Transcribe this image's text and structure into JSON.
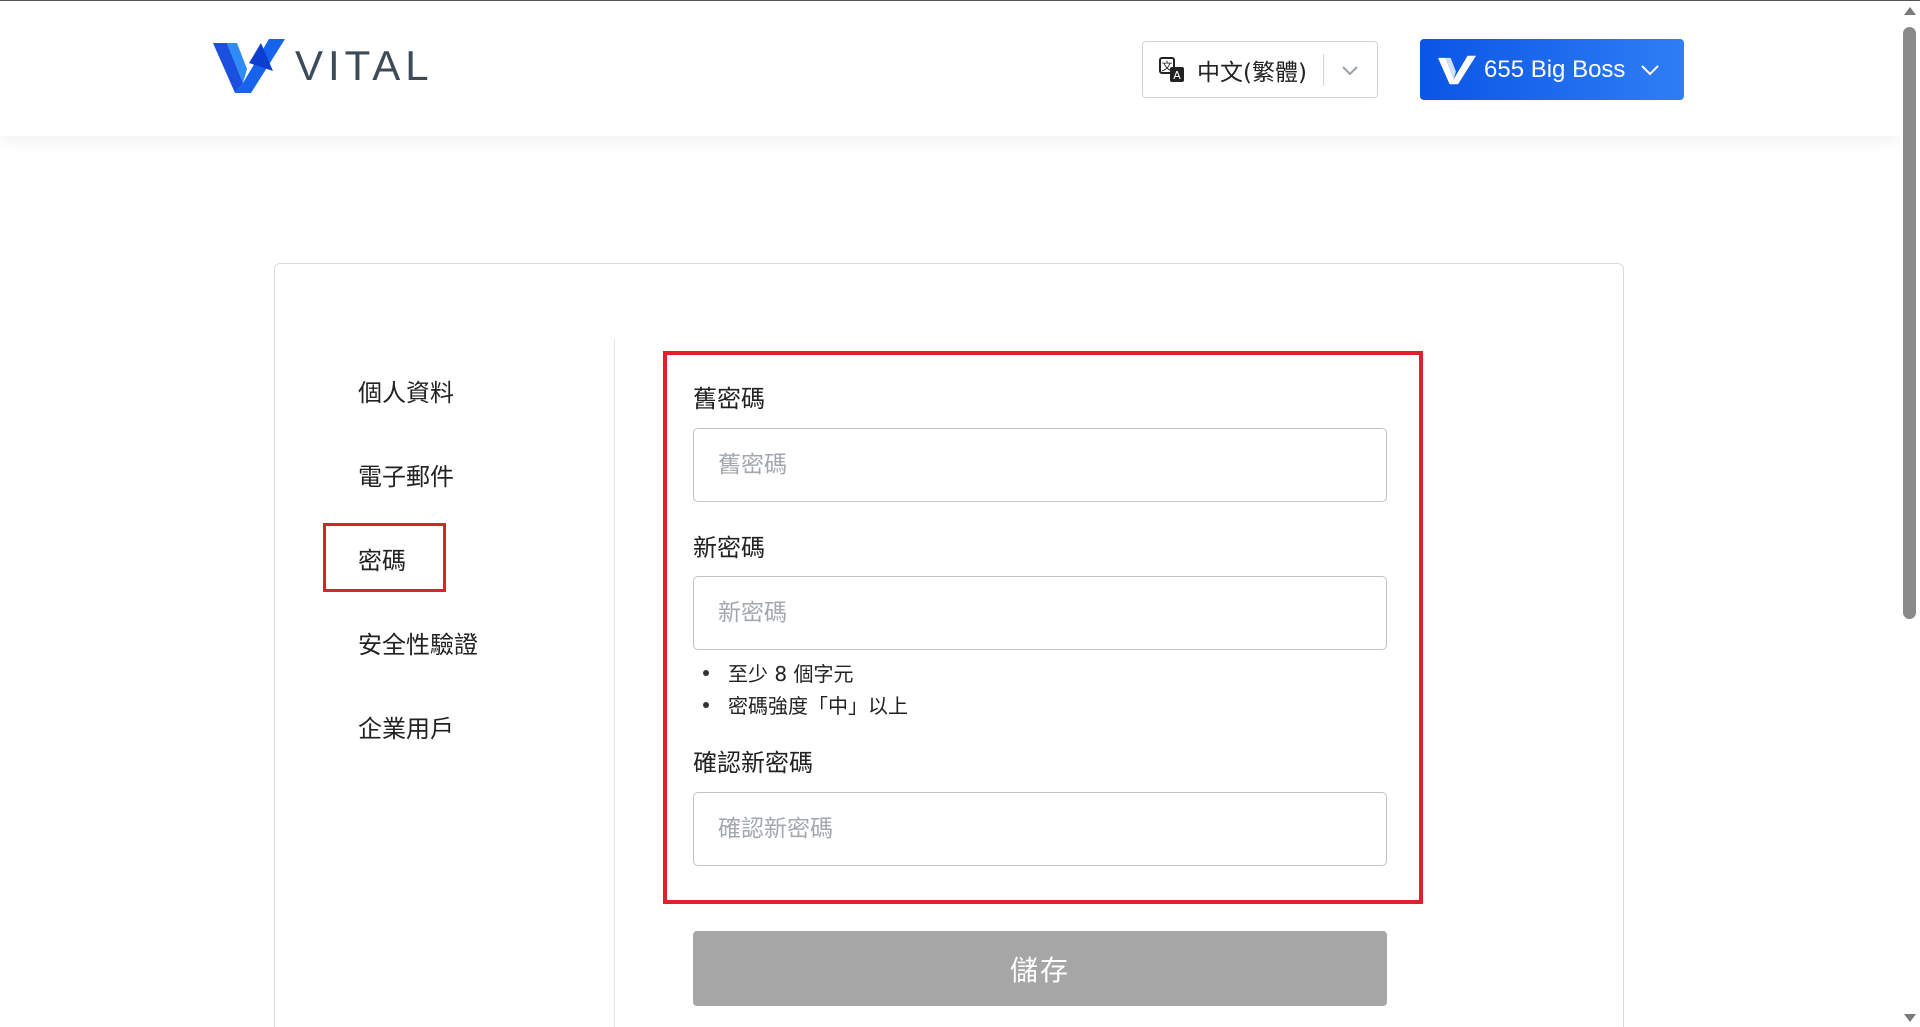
{
  "header": {
    "brand": "VITAL",
    "language": {
      "icon": "translate-icon",
      "selected": "中文(繁體)"
    },
    "user": {
      "label": "655 Big Boss",
      "icon": "vital-mark-icon"
    }
  },
  "sidebar": {
    "items": [
      {
        "label": "個人資料",
        "active": false
      },
      {
        "label": "電子郵件",
        "active": false
      },
      {
        "label": "密碼",
        "active": true
      },
      {
        "label": "安全性驗證",
        "active": false
      },
      {
        "label": "企業用戶",
        "active": false
      }
    ]
  },
  "form": {
    "old_password": {
      "label": "舊密碼",
      "placeholder": "舊密碼",
      "value": ""
    },
    "new_password": {
      "label": "新密碼",
      "placeholder": "新密碼",
      "value": ""
    },
    "rules": [
      "至少 8 個字元",
      "密碼強度「中」以上"
    ],
    "confirm_password": {
      "label": "確認新密碼",
      "placeholder": "確認新密碼",
      "value": ""
    },
    "save_label": "儲存"
  },
  "colors": {
    "accent": "#0a55e6",
    "highlight": "#e0202c",
    "disabled_button": "#a6a6a6"
  }
}
